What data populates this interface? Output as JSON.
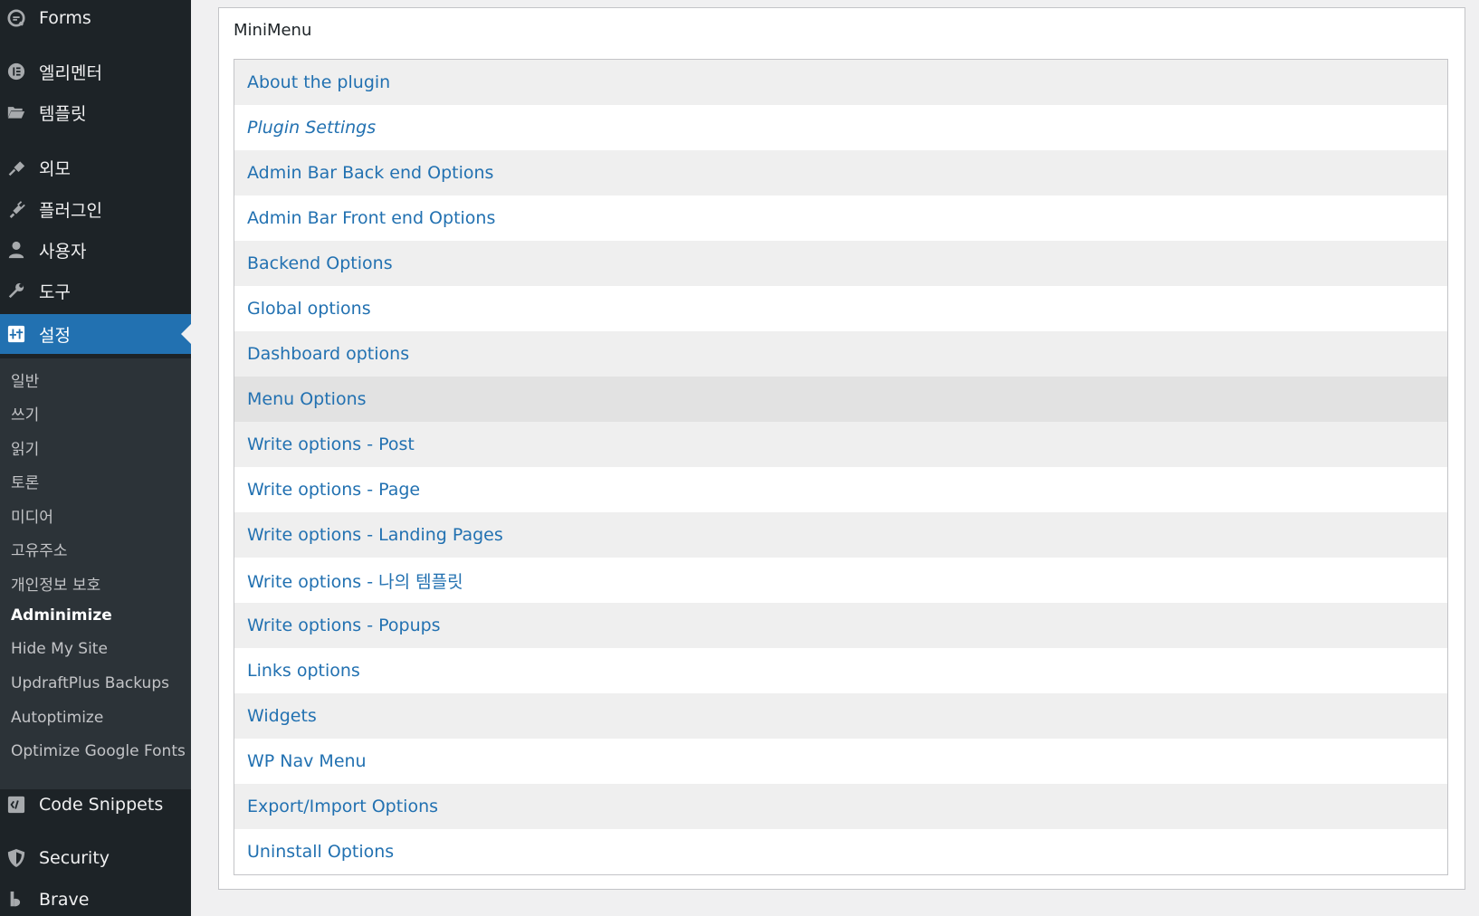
{
  "sidebar": {
    "top_items": [
      {
        "label": "Forms",
        "icon": "forms-icon"
      },
      {
        "label": "엘리멘터",
        "icon": "elementor-icon"
      },
      {
        "label": "템플릿",
        "icon": "folder-icon"
      },
      {
        "label": "외모",
        "icon": "brush-icon"
      },
      {
        "label": "플러그인",
        "icon": "plugin-icon"
      },
      {
        "label": "사용자",
        "icon": "user-icon"
      },
      {
        "label": "도구",
        "icon": "wrench-icon"
      },
      {
        "label": "설정",
        "icon": "settings-icon"
      }
    ],
    "submenu": [
      "일반",
      "쓰기",
      "읽기",
      "토론",
      "미디어",
      "고유주소",
      "개인정보 보호",
      "Adminimize",
      "Hide My Site",
      "UpdraftPlus Backups",
      "Autoptimize",
      "Optimize Google Fonts"
    ],
    "bottom_items": [
      {
        "label": "Code Snippets",
        "icon": "code-icon"
      },
      {
        "label": "Security",
        "icon": "shield-icon"
      },
      {
        "label": "Brave",
        "icon": "brave-icon"
      }
    ],
    "colors": {
      "bg": "#1d2327",
      "active": "#2271b1",
      "submenu_bg": "#2c3338"
    }
  },
  "panel": {
    "title": "MiniMenu",
    "links": [
      "About the plugin",
      "Plugin Settings",
      "Admin Bar Back end Options",
      "Admin Bar Front end Options",
      "Backend Options",
      "Global options",
      "Dashboard options",
      "Menu Options",
      "Write options - Post",
      "Write options - Page",
      "Write options - Landing Pages",
      "Write options - 나의 템플릿",
      "Write options - Popups",
      "Links options",
      "Widgets",
      "WP Nav Menu",
      "Export/Import Options",
      "Uninstall Options"
    ],
    "link_color": "#2271b1"
  }
}
